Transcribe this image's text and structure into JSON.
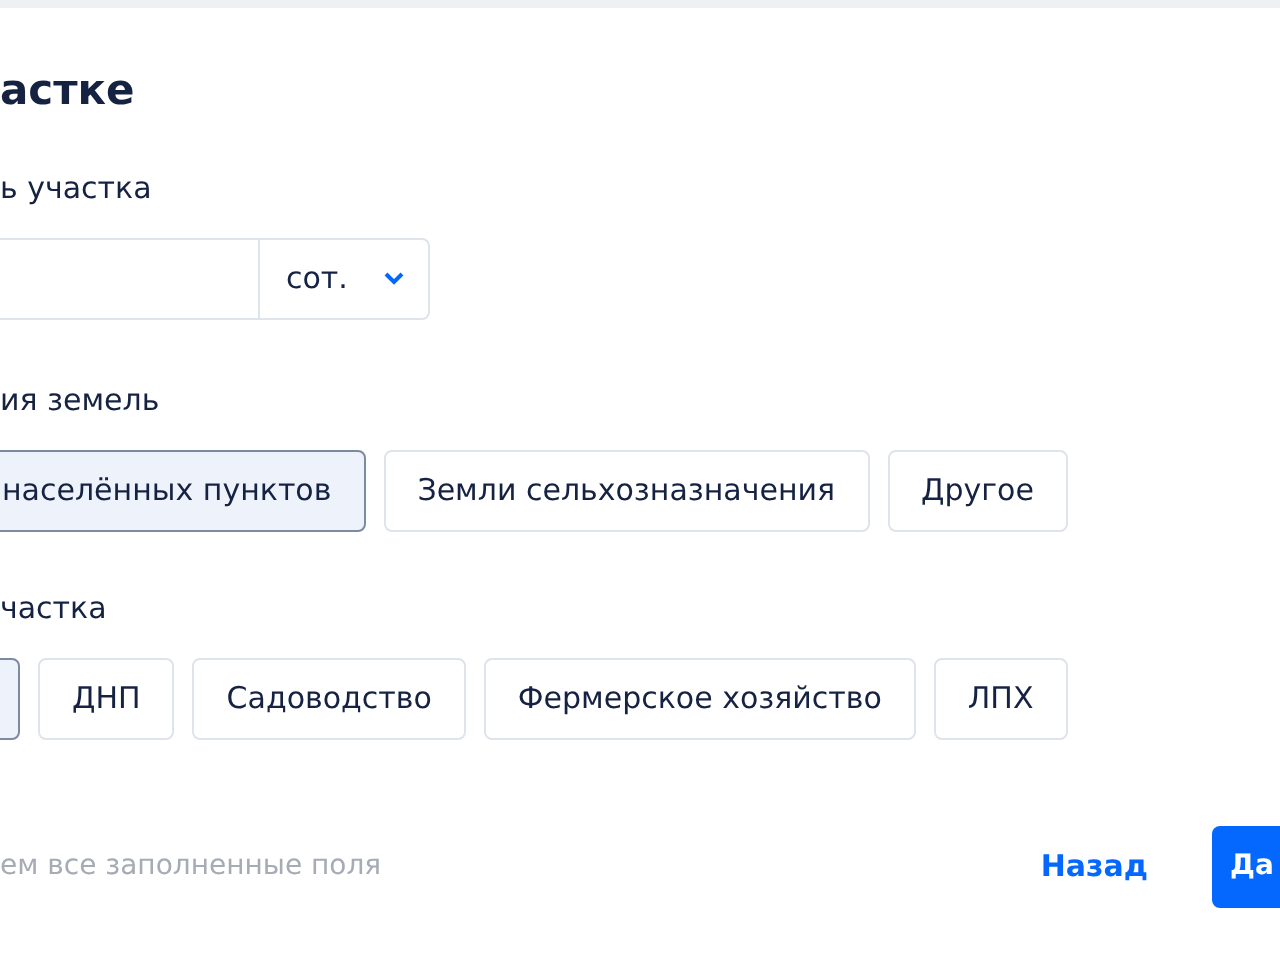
{
  "title": "астке",
  "area": {
    "label": "ь участка",
    "unit": "сот."
  },
  "land_category": {
    "label": "ия земель",
    "options": [
      {
        "label": "населённых пунктов",
        "selected": true
      },
      {
        "label": "Земли сельхозназначения",
        "selected": false
      },
      {
        "label": "Другое",
        "selected": false
      }
    ]
  },
  "plot_type": {
    "label": "частка",
    "options": [
      {
        "selected": true
      },
      {
        "label": "ДНП",
        "selected": false
      },
      {
        "label": "Садоводство",
        "selected": false
      },
      {
        "label": "Фермерское хозяйство",
        "selected": false
      },
      {
        "label": "ЛПХ",
        "selected": false
      }
    ]
  },
  "footer": {
    "hint": "ем все заполненные поля",
    "back": "Назад",
    "next": "Да"
  }
}
